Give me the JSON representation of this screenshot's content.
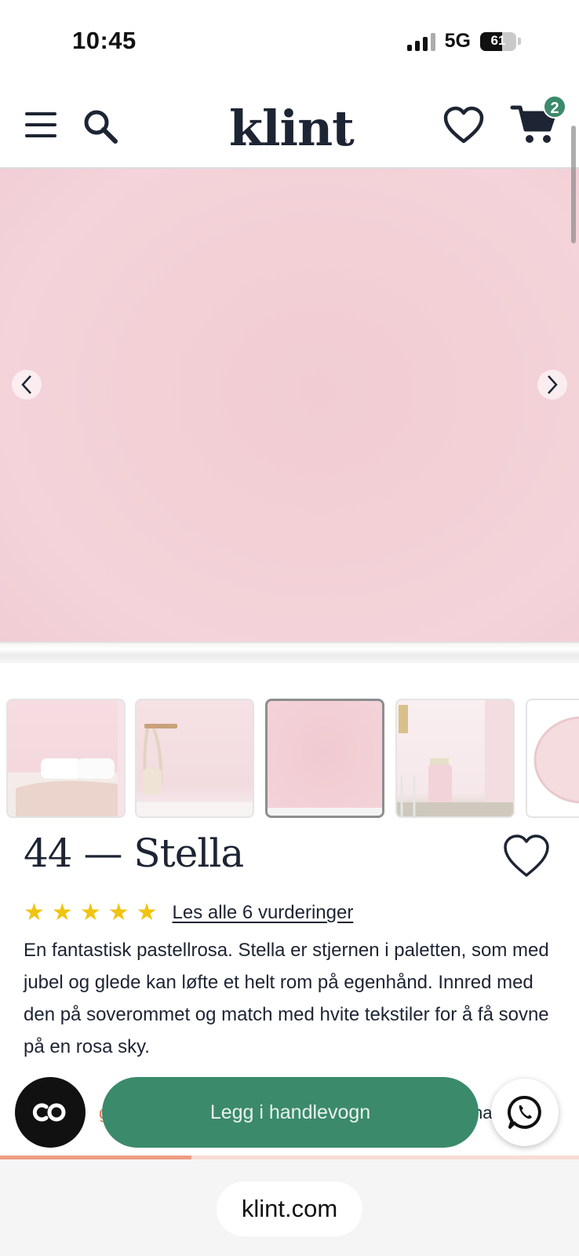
{
  "status_bar": {
    "time": "10:45",
    "network": "5G",
    "battery": "61"
  },
  "header": {
    "logo": "klint",
    "logo_mark": "®",
    "cart_count": "2"
  },
  "product": {
    "title": "44 — Stella",
    "rating": 5,
    "stars": [
      "★",
      "★",
      "★",
      "★",
      "★"
    ],
    "reviews_link": "Les alle 6 vurderinger",
    "description": "En fantastisk pastellrosa. Stella er stjernen i paletten, som med jubel og glede kan løfte et helt rom på egenhånd. Innred med den på soverommet og match med hvite tekstiler for å få sovne på en rosa sky."
  },
  "gallery": {
    "active_index": 2,
    "thumbnail_count": 5
  },
  "actions": {
    "add_to_cart": "Legg i handlevogn",
    "left_peek": "gm",
    "right_peek": "na"
  },
  "scroll_progress": 0.33,
  "browser": {
    "url": "klint.com"
  },
  "colors": {
    "brand_green": "#3b8a6b",
    "paint_pink": "#f2d0d6",
    "star_yellow": "#f1c40f",
    "progress": "#ee9c82"
  }
}
